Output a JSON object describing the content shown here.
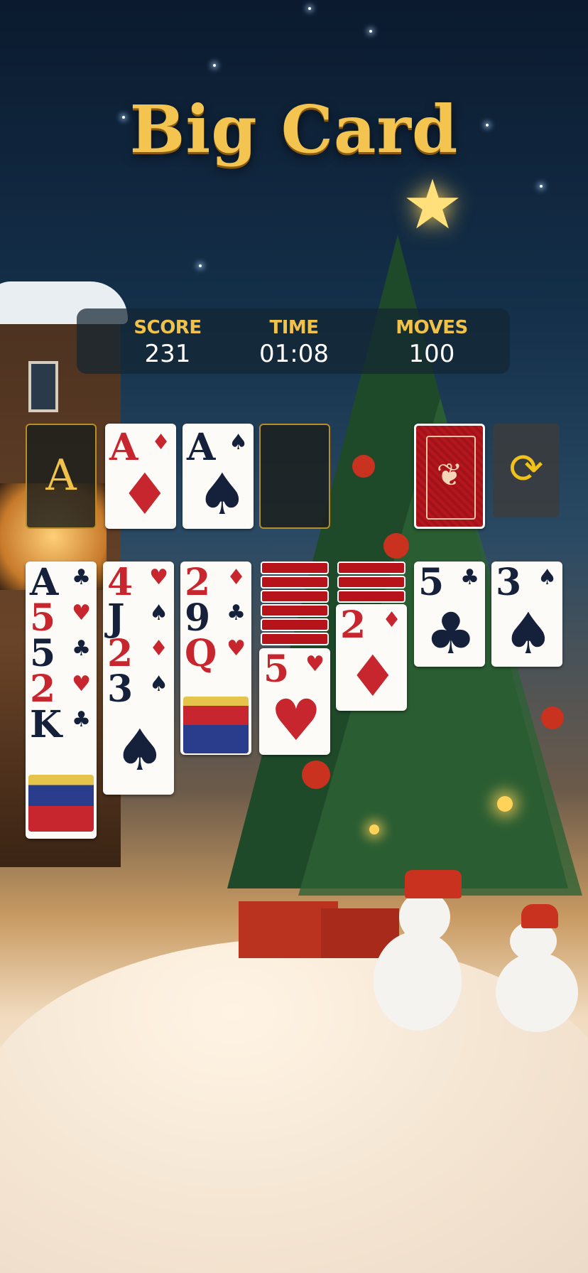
{
  "title": "Big Card",
  "stats": {
    "score_label": "SCORE",
    "score_value": "231",
    "time_label": "TIME",
    "time_value": "01:08",
    "moves_label": "MOVES",
    "moves_value": "100"
  },
  "foundations": [
    {
      "rank": "A",
      "suit": "",
      "style": "empty-gold"
    },
    {
      "rank": "A",
      "suit": "♦"
    },
    {
      "rank": "A",
      "suit": "♠"
    },
    {
      "rank": "",
      "suit": "",
      "style": "empty"
    }
  ],
  "stock": {
    "state": "face-down",
    "recycle_icon": "refresh-icon"
  },
  "tableau": [
    {
      "facedown": 0,
      "cards": [
        {
          "rank": "A",
          "suit": "♣"
        },
        {
          "rank": "5",
          "suit": "♥"
        },
        {
          "rank": "5",
          "suit": "♣"
        },
        {
          "rank": "2",
          "suit": "♥"
        },
        {
          "rank": "K",
          "suit": "♣"
        }
      ]
    },
    {
      "facedown": 0,
      "cards": [
        {
          "rank": "4",
          "suit": "♥"
        },
        {
          "rank": "J",
          "suit": "♠"
        },
        {
          "rank": "2",
          "suit": "♦"
        },
        {
          "rank": "3",
          "suit": "♠"
        }
      ]
    },
    {
      "facedown": 0,
      "cards": [
        {
          "rank": "2",
          "suit": "♦"
        },
        {
          "rank": "9",
          "suit": "♣"
        },
        {
          "rank": "Q",
          "suit": "♥"
        }
      ]
    },
    {
      "facedown": 6,
      "cards": [
        {
          "rank": "5",
          "suit": "♥"
        }
      ]
    },
    {
      "facedown": 3,
      "cards": [
        {
          "rank": "2",
          "suit": "♦"
        }
      ]
    },
    {
      "facedown": 0,
      "cards": [
        {
          "rank": "5",
          "suit": "♣"
        }
      ]
    },
    {
      "facedown": 0,
      "cards": [
        {
          "rank": "3",
          "suit": "♠"
        }
      ]
    }
  ]
}
